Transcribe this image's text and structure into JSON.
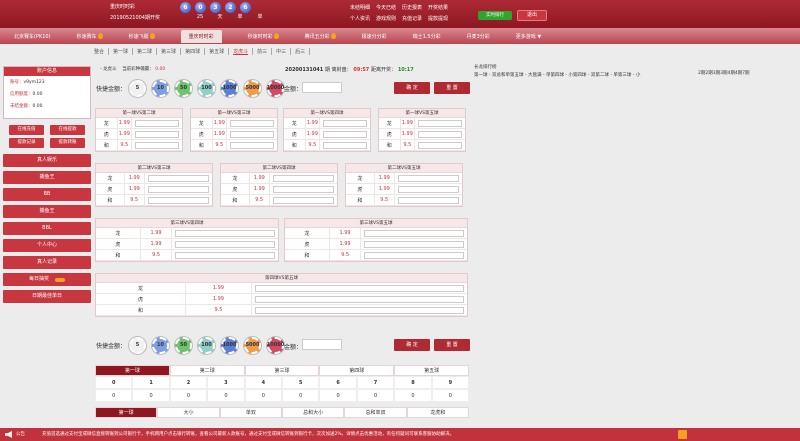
{
  "header": {
    "draw_title": "重庆时时彩",
    "draw_period": "20190521004期开奖",
    "balls": [
      "6",
      "0",
      "3",
      "2",
      "6"
    ],
    "countdown_labels": [
      "25",
      "天",
      "单",
      "单"
    ],
    "links_row1": [
      "未结明细",
      "今天已结",
      "历史报表",
      "开奖结果"
    ],
    "links_row2": [
      "个人资讯",
      "游戏规则",
      "充值记录",
      "提款提现"
    ],
    "rank_label": "实时排行",
    "exit_label": "退出"
  },
  "game_tabs": [
    {
      "label": "北京赛车(PK10)",
      "hot": false,
      "active": false
    },
    {
      "label": "秒速赛车",
      "hot": true,
      "active": false
    },
    {
      "label": "秒速飞艇",
      "hot": true,
      "active": false
    },
    {
      "label": "重庆时时彩",
      "hot": false,
      "active": true
    },
    {
      "label": "秒速时时彩",
      "hot": true,
      "active": false
    },
    {
      "label": "腾讯五分彩",
      "hot": true,
      "active": false
    },
    {
      "label": "极速分分彩",
      "hot": false,
      "active": false
    },
    {
      "label": "瑞士1.5分彩",
      "hot": false,
      "active": false
    },
    {
      "label": "丹麦3分彩",
      "hot": false,
      "active": false
    },
    {
      "label": "更多游戏 ▼",
      "hot": false,
      "active": false
    }
  ],
  "sub_tabs": [
    "整合",
    "第一球",
    "第二球",
    "第三球",
    "第四球",
    "第五球",
    "龙虎斗",
    "前三",
    "中三",
    "后三"
  ],
  "sub_tab_active": 6,
  "sidebar": {
    "account_title": "账户信息",
    "account_label": "账号：",
    "account_value": "v9ym123",
    "credit_label": "信用额度：",
    "credit_value": "0.00",
    "unsettled_label": "未结金额：",
    "unsettled_value": "0.00",
    "grid_buttons": [
      "在线充值",
      "在线提款",
      "提款记录",
      "提款转账"
    ],
    "menu": [
      "真人娱乐",
      "捕鱼王",
      "BB",
      "捕鱼王",
      "BBL",
      "个人中心",
      "真人记录"
    ],
    "daily_label": "每日抽奖",
    "bet_review_label": "日期最佳单日"
  },
  "info": {
    "mode_label": "龙虎斗",
    "odds_label": "当前彩种输赢：",
    "odds_value": "0.00",
    "period": "20200131041",
    "close_label": "期 离封盘：",
    "close_time": "09:57",
    "open_label": "距离开奖：",
    "open_time": "10:17"
  },
  "long_dragon": {
    "title": "长龙排行榜",
    "text": "第一球 - 双总和单第五球 - 大盘满 - 单第四球 - 小第四球 - 双第二球 - 单第三球 - 小",
    "numbers": "2期2期3期3期4期4期7期"
  },
  "bet": {
    "quick_label": "快捷金额：",
    "chips": [
      "5",
      "10",
      "50",
      "100",
      "1000",
      "5000",
      "10000"
    ],
    "amount_label": "金额：",
    "confirm_label": "确 定",
    "reset_label": "重 置"
  },
  "pair_tables": [
    {
      "title": "第一球VS第二球",
      "rows": [
        {
          "label": "龙",
          "odds": "1.99"
        },
        {
          "label": "虎",
          "odds": "1.99"
        },
        {
          "label": "和",
          "odds": "9.5"
        }
      ]
    },
    {
      "title": "第一球VS第三球",
      "rows": [
        {
          "label": "龙",
          "odds": "1.99"
        },
        {
          "label": "虎",
          "odds": "1.99"
        },
        {
          "label": "和",
          "odds": "9.5"
        }
      ]
    },
    {
      "title": "第一球VS第四球",
      "rows": [
        {
          "label": "龙",
          "odds": "1.99"
        },
        {
          "label": "虎",
          "odds": "1.99"
        },
        {
          "label": "和",
          "odds": "9.5"
        }
      ]
    },
    {
      "title": "第一球VS第五球",
      "rows": [
        {
          "label": "龙",
          "odds": "1.99"
        },
        {
          "label": "虎",
          "odds": "1.99"
        },
        {
          "label": "和",
          "odds": "9.5"
        }
      ]
    },
    {
      "title": "第二球VS第三球",
      "rows": [
        {
          "label": "龙",
          "odds": "1.99"
        },
        {
          "label": "虎",
          "odds": "1.99"
        },
        {
          "label": "和",
          "odds": "9.5"
        }
      ]
    },
    {
      "title": "第二球VS第四球",
      "rows": [
        {
          "label": "龙",
          "odds": "1.99"
        },
        {
          "label": "虎",
          "odds": "1.99"
        },
        {
          "label": "和",
          "odds": "9.5"
        }
      ]
    },
    {
      "title": "第二球VS第五球",
      "rows": [
        {
          "label": "龙",
          "odds": "1.99"
        },
        {
          "label": "虎",
          "odds": "1.99"
        },
        {
          "label": "和",
          "odds": "9.5"
        }
      ]
    },
    {
      "title": "第三球VS第四球",
      "rows": [
        {
          "label": "龙",
          "odds": "1.99"
        },
        {
          "label": "虎",
          "odds": "1.99"
        },
        {
          "label": "和",
          "odds": "9.5"
        }
      ]
    },
    {
      "title": "第三球VS第五球",
      "rows": [
        {
          "label": "龙",
          "odds": "1.99"
        },
        {
          "label": "虎",
          "odds": "1.99"
        },
        {
          "label": "和",
          "odds": "9.5"
        }
      ]
    },
    {
      "title": "第四球VS第五球",
      "rows": [
        {
          "label": "龙",
          "odds": "1.99"
        },
        {
          "label": "虎",
          "odds": "1.99"
        },
        {
          "label": "和",
          "odds": "9.5"
        }
      ]
    }
  ],
  "results": {
    "ball_tabs": [
      "第一球",
      "第二球",
      "第三球",
      "第四球",
      "第五球"
    ],
    "numbers": [
      "0",
      "1",
      "2",
      "3",
      "4",
      "5",
      "6",
      "7",
      "8",
      "9"
    ],
    "counts": [
      "0",
      "0",
      "0",
      "0",
      "0",
      "0",
      "0",
      "0",
      "0",
      "0"
    ],
    "stat_tabs": [
      "第一球",
      "大小",
      "单双",
      "总和大小",
      "总和单双",
      "龙虎和"
    ]
  },
  "notice": {
    "label": "公告",
    "text": "充值首选通过支付宝或微信直接转账到公司银行卡，手机网用户点击银行转账，查看公司最新入款账号，通过支付宝或微信转账到银行卡，次次加送2%，详情点击优惠活动，有任何疑问可联系客服协助解决。"
  },
  "colors": {
    "primary": "#c8363f",
    "dark": "#8e1722",
    "accent": "#2ea52e"
  }
}
